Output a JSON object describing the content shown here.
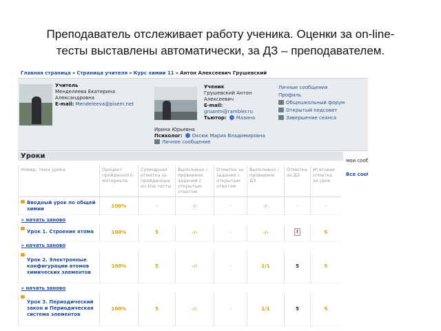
{
  "caption": {
    "line1": "Преподаватель отслеживает работу ученика. Оценки за on-line-",
    "line2": "тесты выставлены автоматически, за ДЗ – преподавателем."
  },
  "breadcrumb": {
    "items": [
      "Главная страница",
      "Страница учителя",
      "Курс химии 11"
    ],
    "current": "Антон Алексеевич Грушевский",
    "separator": "»"
  },
  "teacher": {
    "label": "Учитель",
    "name_line1": "Менделеева Екатерина",
    "name_line2": "Александровна",
    "email_label": "E-mail:",
    "email": "Mendeleeva@pisem.net"
  },
  "student": {
    "label": "Ученик",
    "name_line1": "Грушевский Антон",
    "name_line2": "Алексеевич",
    "email_label": "E-mail:",
    "email": "gruantn@rambler.ru",
    "tutor_label": "Тьютор:",
    "tutor_name": "Мазина",
    "tutor_first": "Ирина Юрьевна",
    "psych_label": "Психолог:",
    "psych_name": "Оксюк Мария Владимировна",
    "message_link": "Личное сообщение"
  },
  "links": {
    "messages": "Личные сообщения",
    "profile": "Профиль",
    "forum": "Общешкольный форум",
    "teachers_room": "Открытый педсовет",
    "end_session": "Завершение сеанса"
  },
  "lessons": {
    "title": "Уроки",
    "my_messages": "мои сообщения",
    "all_messages": "Все сообщения »",
    "headers": [
      "Номер, тема урока",
      "Процент пройденного материала",
      "Суммарная отметка за пройденные on-line тесты",
      "Выполнено / проверено заданий с открытым ответом",
      "Отметка за задания с открытым ответом",
      "Выполнено / проверено ДЗ",
      "Отметка за ДЗ",
      "Итоговая отметка за урок"
    ],
    "restart_label": "начать заново",
    "rows": [
      {
        "name": "Вводный урок по общей химии",
        "percent": "100%",
        "tests": "-",
        "open_done": "-/-",
        "open_mark": "-",
        "hw_done": "-/-",
        "hw_mark": "-",
        "final": "-"
      },
      {
        "name": "Урок 1. Строение атома",
        "percent": "100%",
        "tests": "5",
        "open_done": "-/-",
        "open_mark": "-",
        "hw_done": "-/-",
        "hw_mark": "!",
        "final": "5"
      },
      {
        "name": "Урок 2. Электронные конфигурации атомов химических элементов",
        "percent": "100%",
        "tests": "5",
        "open_done": "-/-",
        "open_mark": "-",
        "hw_done": "1/1",
        "hw_mark": "5",
        "final": "5"
      },
      {
        "name": "Урок 3. Периодический закон и Периодическая система элементов",
        "percent": "100%",
        "tests": "5",
        "open_done": "-/-",
        "open_mark": "-",
        "hw_done": "1/1",
        "hw_mark": "5",
        "final": "5"
      }
    ]
  }
}
